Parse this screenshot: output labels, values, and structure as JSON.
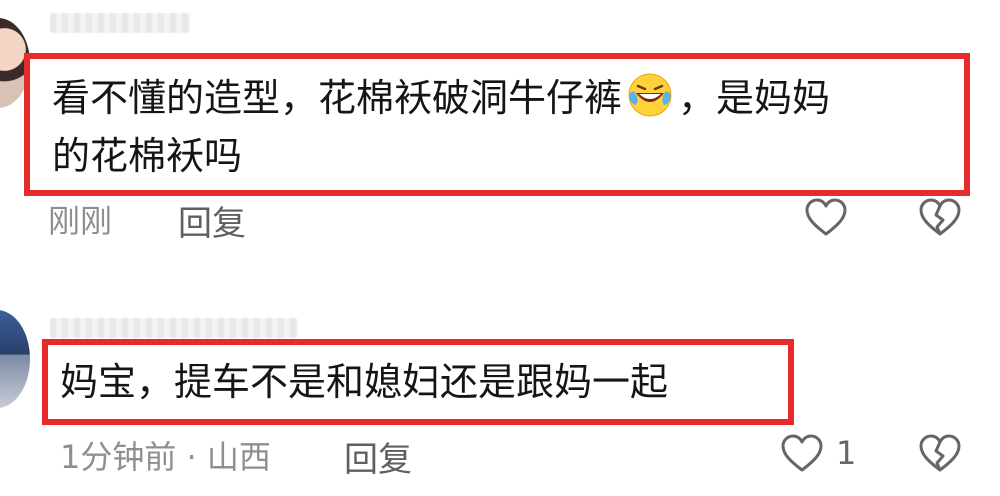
{
  "comments": [
    {
      "text_before_emoji": "看不懂的造型，花棉袄破洞牛仔裤",
      "emoji": "laughing-crying-emoji",
      "text_after_emoji": "，是妈妈",
      "text_line2": "的花棉袄吗",
      "time": "刚刚",
      "reply_label": "回复"
    },
    {
      "text": "妈宝，提车不是和媳妇还是跟妈一起",
      "time_location": "1分钟前 · 山西",
      "reply_label": "回复",
      "like_count": "1"
    }
  ],
  "icons": {
    "like": "heart-outline-icon",
    "dislike": "broken-heart-icon"
  },
  "colors": {
    "highlight_border": "#e62b2b",
    "meta_text": "#8f8f8f",
    "icon_stroke": "#666666"
  }
}
